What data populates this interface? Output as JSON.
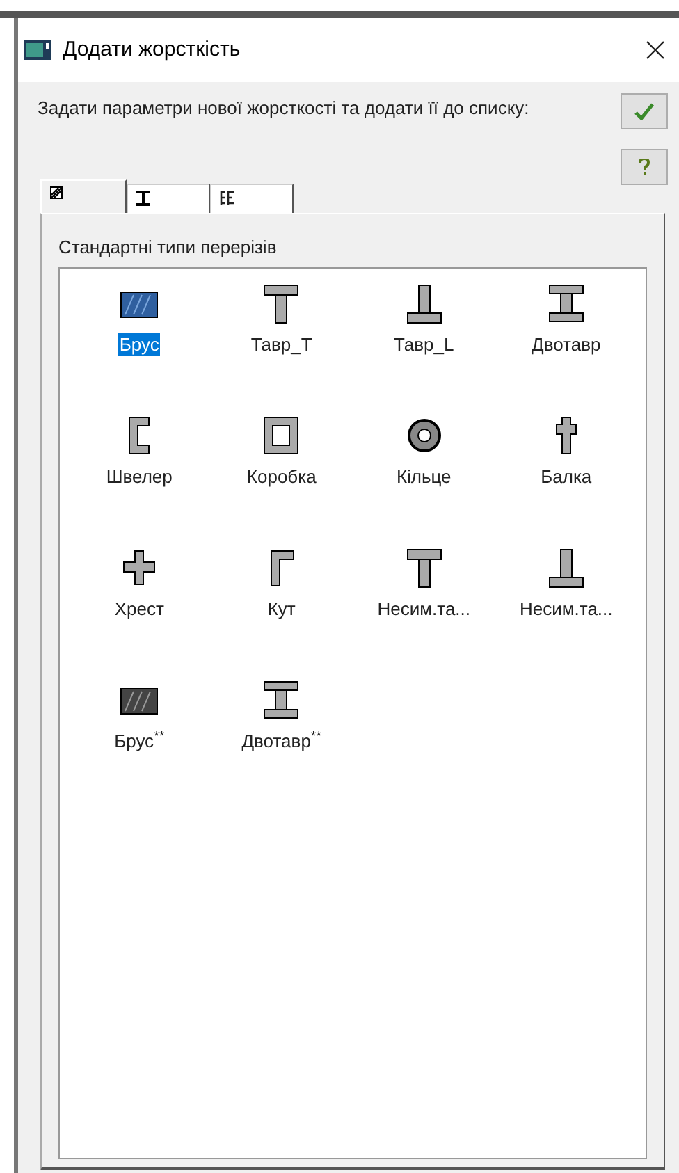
{
  "window": {
    "title": "Додати жорсткість"
  },
  "description": "Задати параметри нової жорсткості та додати її до списку:",
  "buttons": [
    {
      "kind": "ok"
    },
    {
      "kind": "help"
    }
  ],
  "tabs": [
    {
      "kind": "hatch",
      "selected": true
    },
    {
      "kind": "ibeam",
      "selected": false
    },
    {
      "kind": "double",
      "selected": false
    }
  ],
  "group": {
    "label": "Стандартні типи перерізів"
  },
  "sections": [
    {
      "label": "Брус",
      "kind": "rect",
      "selected": true
    },
    {
      "label": "Тавр_Т",
      "kind": "tee",
      "selected": false
    },
    {
      "label": "Тавр_L",
      "kind": "teeinv",
      "selected": false
    },
    {
      "label": "Двотавр",
      "kind": "ibeam",
      "selected": false
    },
    {
      "label": "Швелер",
      "kind": "channel",
      "selected": false
    },
    {
      "label": "Коробка",
      "kind": "box",
      "selected": false
    },
    {
      "label": "Кільце",
      "kind": "ring",
      "selected": false
    },
    {
      "label": "Балка",
      "kind": "beam",
      "selected": false
    },
    {
      "label": "Хрест",
      "kind": "cross",
      "selected": false
    },
    {
      "label": "Кут",
      "kind": "angle",
      "selected": false
    },
    {
      "label": "Несим.та...",
      "kind": "tee",
      "selected": false
    },
    {
      "label": "Несим.та...",
      "kind": "teeinv",
      "selected": false
    },
    {
      "label": "Брус$^{**}$",
      "kind": "rect",
      "selected": false
    },
    {
      "label": "Двотавр$^{**}$",
      "kind": "ibeam",
      "selected": false
    }
  ]
}
